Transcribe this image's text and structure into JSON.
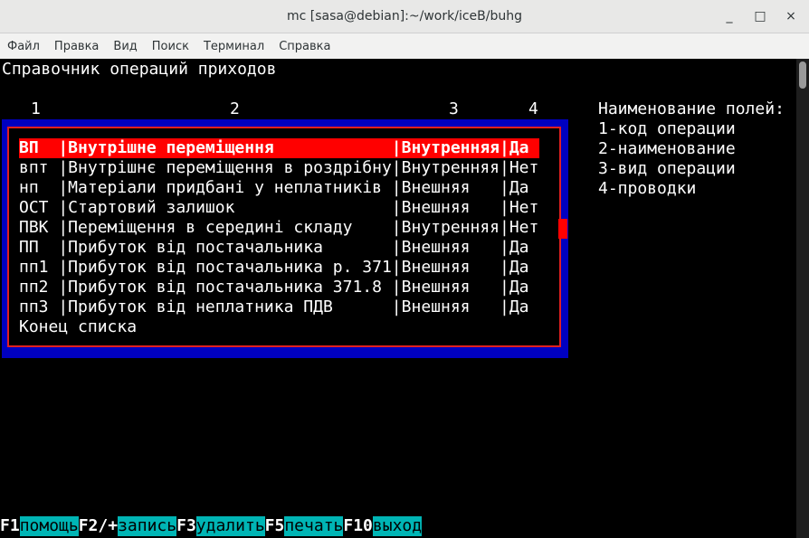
{
  "window": {
    "title": "mc [sasa@debian]:~/work/iceB/buhg",
    "controls": [
      "_",
      "□",
      "×"
    ]
  },
  "menu": [
    "Файл",
    "Правка",
    "Вид",
    "Поиск",
    "Терминал",
    "Справка"
  ],
  "screen": {
    "heading": "Справочник операций приходов",
    "column_numbers": [
      "1",
      "2",
      "3",
      "4"
    ],
    "legend": {
      "title": "Наименование полей:",
      "items": [
        "1-код операции",
        "2-наименование",
        "3-вид операции",
        "4-проводки"
      ]
    },
    "rows": [
      {
        "code": "ВП",
        "name": "Внутрішне переміщення",
        "kind": "Внутренняя",
        "post": "Да"
      },
      {
        "code": "впт",
        "name": "Внутрішнє переміщення в роздрібну",
        "kind": "Внутренняя",
        "post": "Нет"
      },
      {
        "code": "нп",
        "name": "Матеріали придбані у неплатників",
        "kind": "Внешняя",
        "post": "Да"
      },
      {
        "code": "ОСТ",
        "name": "Стартовий залишок",
        "kind": "Внешняя",
        "post": "Нет"
      },
      {
        "code": "ПВК",
        "name": "Переміщення в середині складу",
        "kind": "Внутренняя",
        "post": "Нет"
      },
      {
        "code": "ПП",
        "name": "Прибуток від постачальника",
        "kind": "Внешняя",
        "post": "Да"
      },
      {
        "code": "пп1",
        "name": "Прибуток від постачальника р. 371",
        "kind": "Внешняя",
        "post": "Да"
      },
      {
        "code": "пп2",
        "name": "Прибуток від постачальника 371.8",
        "kind": "Внешняя",
        "post": "Да"
      },
      {
        "code": "пп3",
        "name": "Прибуток від неплатника ПДВ",
        "kind": "Внешняя",
        "post": "Да"
      }
    ],
    "end_of_list": "Конец списка"
  },
  "fkeys": [
    {
      "key": "F1",
      "label": "помощь"
    },
    {
      "key": "F2/+",
      "label": "запись"
    },
    {
      "key": "F3",
      "label": "удалить"
    },
    {
      "key": "F5",
      "label": "печать"
    },
    {
      "key": "F10",
      "label": "выход"
    }
  ],
  "colors": {
    "frame_blue": "#0000c0",
    "selection_red": "#ff0000",
    "fkey_label_bg": "#00b5b5"
  }
}
